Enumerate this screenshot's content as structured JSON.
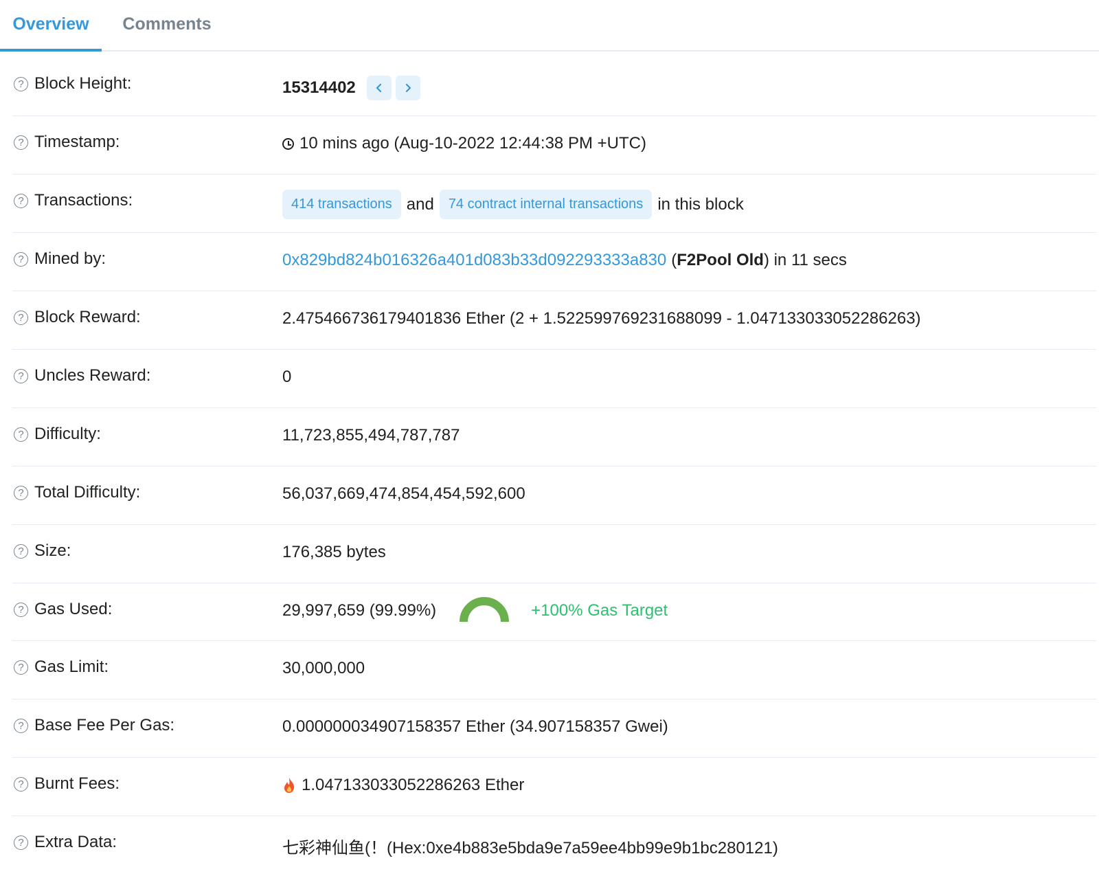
{
  "tabs": [
    {
      "label": "Overview",
      "active": true
    },
    {
      "label": "Comments",
      "active": false
    }
  ],
  "rows": {
    "block_height": {
      "label": "Block Height:",
      "value": "15314402",
      "prev_icon": "chevron-left-icon",
      "next_icon": "chevron-right-icon"
    },
    "timestamp": {
      "label": "Timestamp:",
      "icon": "clock-icon",
      "value": "10 mins ago (Aug-10-2022 12:44:38 PM +UTC)"
    },
    "transactions": {
      "label": "Transactions:",
      "tx_link": "414 transactions",
      "and": "and",
      "internal_link": "74 contract internal transactions",
      "suffix": "in this block"
    },
    "mined_by": {
      "label": "Mined by:",
      "address": "0x829bd824b016326a401d083b33d092293333a830",
      "open_paren": "(",
      "pool_name": "F2Pool Old",
      "suffix": ") in 11 secs"
    },
    "block_reward": {
      "label": "Block Reward:",
      "value": "2.475466736179401836 Ether (2 + 1.522599769231688099 - 1.047133033052286263)"
    },
    "uncles_reward": {
      "label": "Uncles Reward:",
      "value": "0"
    },
    "difficulty": {
      "label": "Difficulty:",
      "value": "11,723,855,494,787,787"
    },
    "total_difficulty": {
      "label": "Total Difficulty:",
      "value": "56,037,669,474,854,454,592,600"
    },
    "size": {
      "label": "Size:",
      "value": "176,385 bytes"
    },
    "gas_used": {
      "label": "Gas Used:",
      "value": "29,997,659 (99.99%)",
      "gauge_fraction": 0.9999,
      "target": "+100% Gas Target"
    },
    "gas_limit": {
      "label": "Gas Limit:",
      "value": "30,000,000"
    },
    "base_fee": {
      "label": "Base Fee Per Gas:",
      "value": "0.000000034907158357 Ether (34.907158357 Gwei)"
    },
    "burnt_fees": {
      "label": "Burnt Fees:",
      "icon": "fire-icon",
      "value": "1.047133033052286263 Ether"
    },
    "extra_data": {
      "label": "Extra Data:",
      "value": "七彩神仙鱼(！(Hex:0xe4b883e5bda9e7a59ee4bb99e9b1bc280121)"
    }
  },
  "colors": {
    "accent": "#3498db",
    "pill_bg": "#e5f1fb",
    "gas_target": "#2fbf71",
    "gauge": "#6ab04c",
    "divider": "#e7eaf3"
  }
}
